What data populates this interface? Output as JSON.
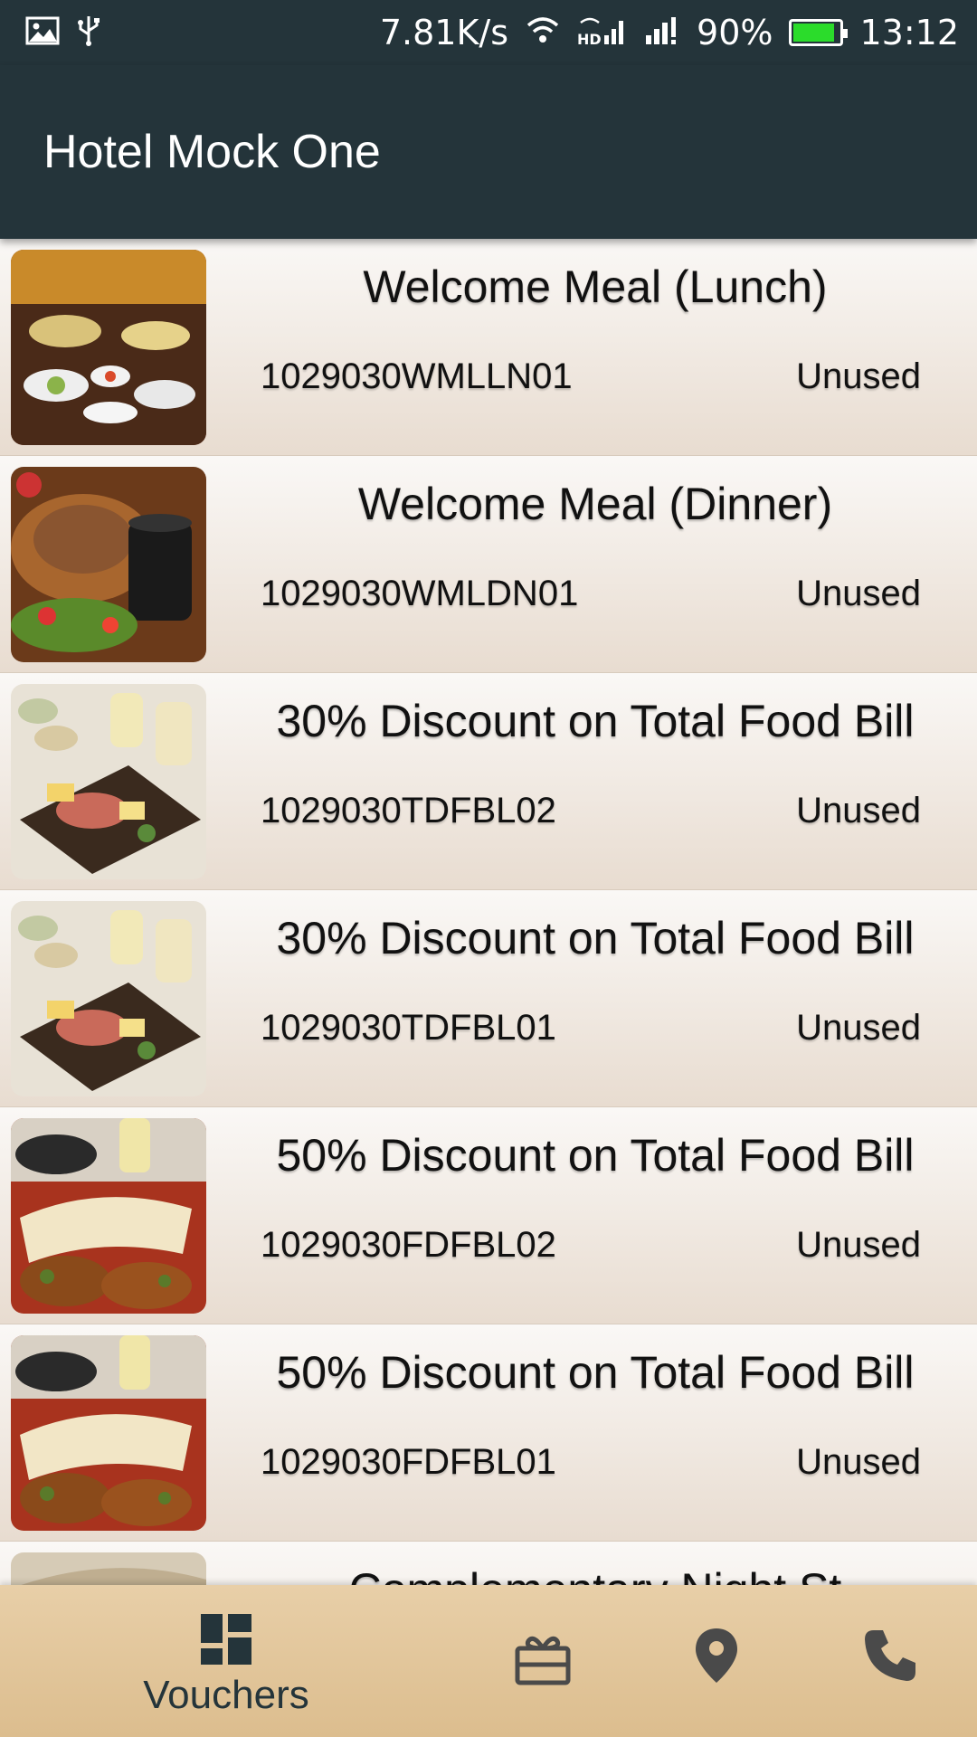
{
  "status_bar": {
    "net_speed": "7.81K/s",
    "battery": "90%",
    "battery_level": 0.9,
    "time": "13:12",
    "icons": [
      "image-icon",
      "usb-icon",
      "wifi-icon",
      "hd-signal-icon",
      "signal-icon"
    ]
  },
  "app_bar": {
    "title": "Hotel Mock One"
  },
  "vouchers": [
    {
      "title": "Welcome Meal (Lunch)",
      "code": "1029030WMLLN01",
      "status": "Unused"
    },
    {
      "title": "Welcome Meal (Dinner)",
      "code": "1029030WMLDN01",
      "status": "Unused"
    },
    {
      "title": "30% Discount on Total Food Bill",
      "code": "1029030TDFBL02",
      "status": "Unused"
    },
    {
      "title": "30% Discount on Total Food Bill",
      "code": "1029030TDFBL01",
      "status": "Unused"
    },
    {
      "title": "50% Discount on Total Food Bill",
      "code": "1029030FDFBL02",
      "status": "Unused"
    },
    {
      "title": "50% Discount on Total Food Bill",
      "code": "1029030FDFBL01",
      "status": "Unused"
    },
    {
      "title": "Complementary Night St",
      "code": "",
      "status": ""
    }
  ],
  "bottom_nav": {
    "vouchers_label": "Vouchers",
    "icons": [
      "dashboard-icon",
      "gift-icon",
      "location-icon",
      "phone-icon"
    ]
  },
  "colors": {
    "app_bar": "#24343a",
    "battery_fill": "#2bdc2b",
    "nav_background": "#e3c69b"
  }
}
